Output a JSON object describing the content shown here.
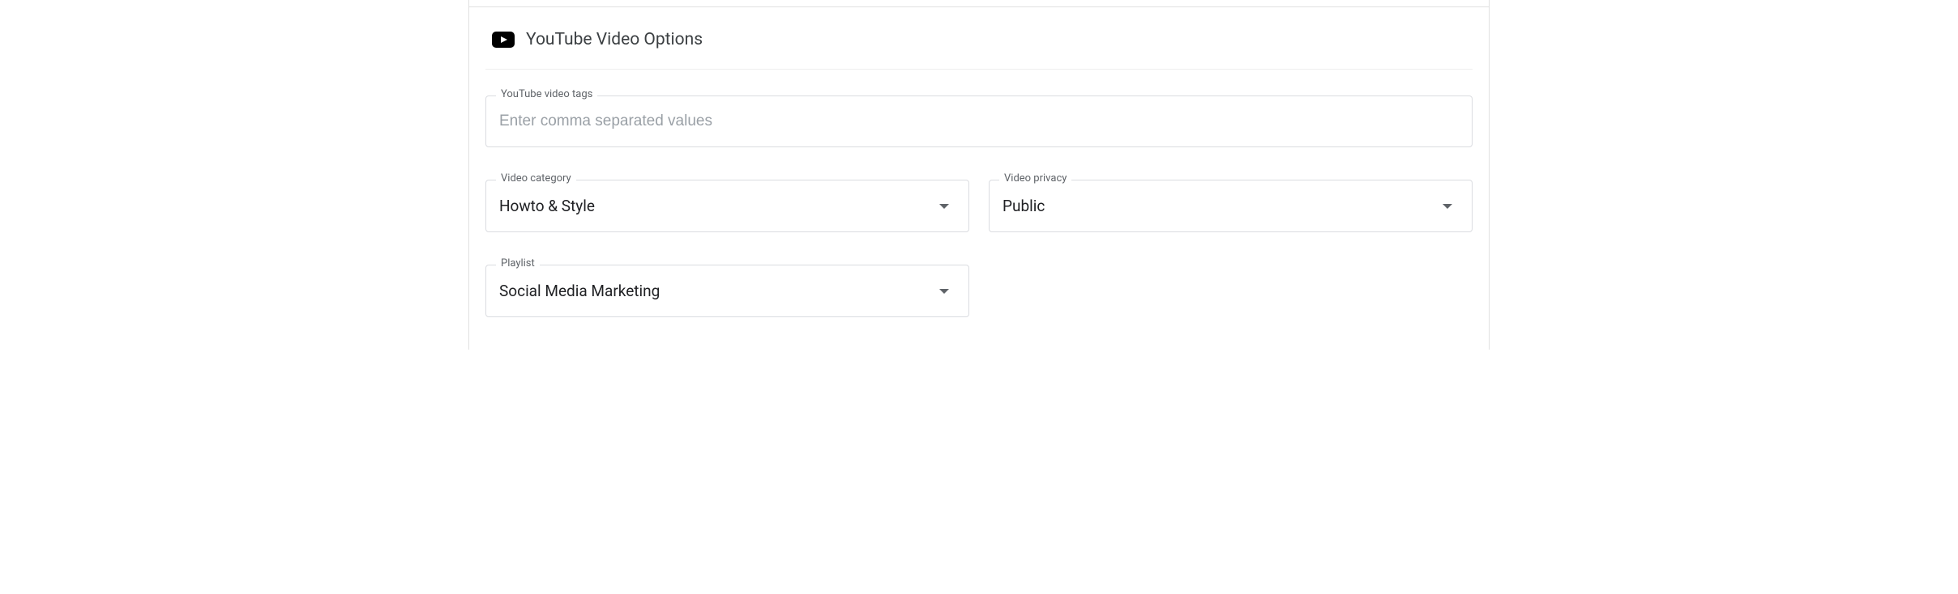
{
  "section": {
    "title": "YouTube Video Options"
  },
  "fields": {
    "tags": {
      "label": "YouTube video tags",
      "placeholder": "Enter comma separated values",
      "value": ""
    },
    "category": {
      "label": "Video category",
      "value": "Howto & Style"
    },
    "privacy": {
      "label": "Video privacy",
      "value": "Public"
    },
    "playlist": {
      "label": "Playlist",
      "value": "Social Media Marketing"
    }
  }
}
